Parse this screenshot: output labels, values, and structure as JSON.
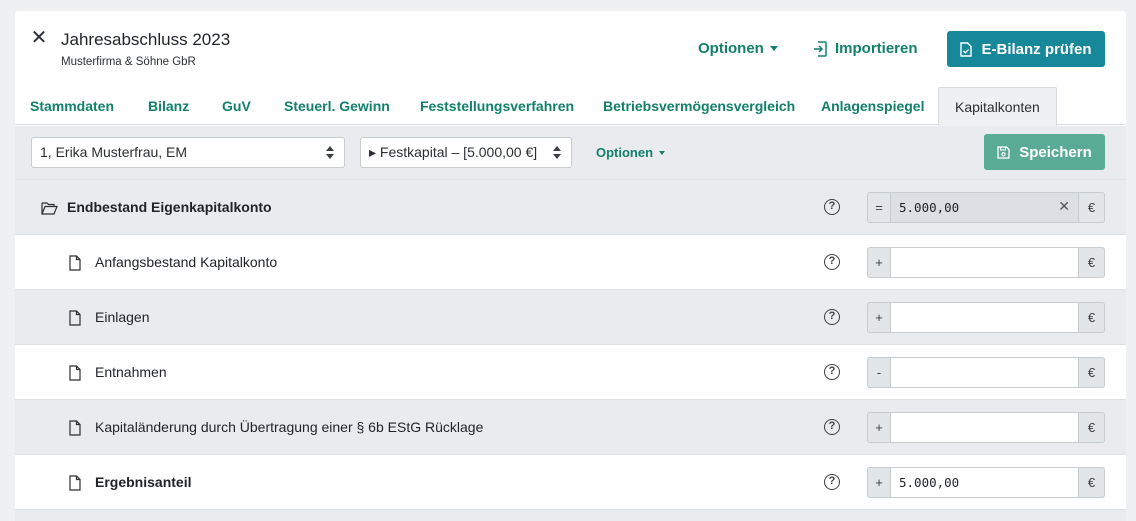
{
  "header": {
    "title": "Jahresabschluss 2023",
    "subtitle": "Musterfirma & Söhne GbR",
    "options_label": "Optionen",
    "import_label": "Importieren",
    "ebilanz_label": "E-Bilanz prüfen"
  },
  "tabs": [
    {
      "label": "Stammdaten"
    },
    {
      "label": "Bilanz"
    },
    {
      "label": "GuV"
    },
    {
      "label": "Steuerl. Gewinn"
    },
    {
      "label": "Feststellungsverfahren"
    },
    {
      "label": "Betriebsvermögensvergleich"
    },
    {
      "label": "Anlagenspiegel"
    },
    {
      "label": "Kapitalkonten",
      "active": true
    }
  ],
  "toolbar": {
    "partner_select": "1, Erika Musterfrau, EM",
    "account_select": "▸ Festkapital – [5.000,00 €]",
    "options_label": "Optionen",
    "save_label": "Speichern"
  },
  "rows": [
    {
      "label": "Endbestand Eigenkapitalkonto",
      "prefix": "=",
      "value": "5.000,00",
      "suffix": "€",
      "help": "?"
    },
    {
      "label": "Anfangsbestand Kapitalkonto",
      "prefix": "+",
      "value": "",
      "suffix": "€",
      "help": "?"
    },
    {
      "label": "Einlagen",
      "prefix": "+",
      "value": "",
      "suffix": "€",
      "help": "?"
    },
    {
      "label": "Entnahmen",
      "prefix": "-",
      "value": "",
      "suffix": "€",
      "help": "?"
    },
    {
      "label": "Kapitaländerung durch Übertragung einer § 6b EStG Rücklage",
      "prefix": "+",
      "value": "",
      "suffix": "€",
      "help": "?"
    },
    {
      "label": "Ergebnisanteil",
      "prefix": "+",
      "value": "5.000,00",
      "suffix": "€",
      "help": "?"
    }
  ],
  "colors": {
    "accent_green": "#12806b",
    "primary_button": "#17889a",
    "save_button": "#5aab96"
  }
}
